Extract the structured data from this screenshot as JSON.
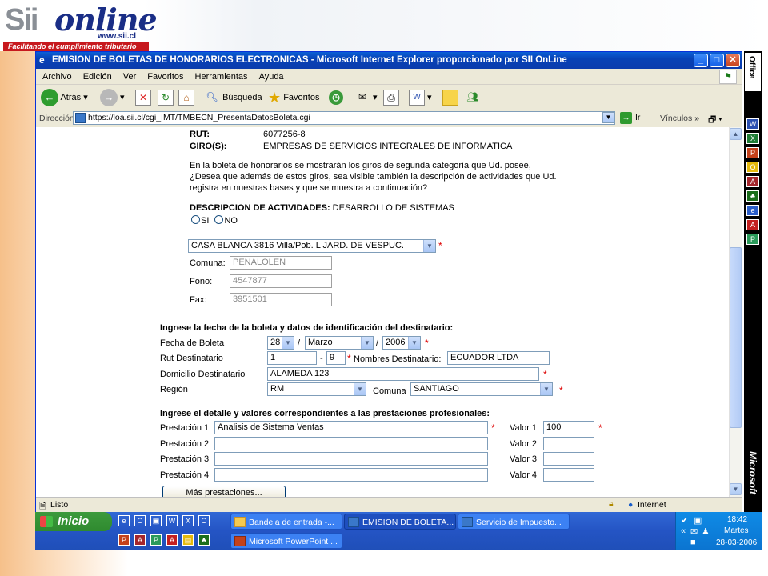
{
  "slide": {
    "logo_sii": "Sii",
    "logo_online": "online",
    "logo_url": "www.sii.cl",
    "logo_tagline": "Facilitando el cumplimiento tributario"
  },
  "window": {
    "title": "EMISION DE BOLETAS DE HONORARIOS ELECTRONICAS - Microsoft Internet Explorer proporcionado por SII OnLine",
    "menu": [
      "Archivo",
      "Edición",
      "Ver",
      "Favoritos",
      "Herramientas",
      "Ayuda"
    ],
    "toolbar": {
      "back": "Atrás",
      "search": "Búsqueda",
      "favorites": "Favoritos"
    },
    "address_label": "Dirección",
    "address_url": "https://loa.sii.cl/cgi_IMT/TMBECN_PresentaDatosBoleta.cgi",
    "go_label": "Ir",
    "links_label": "Vínculos",
    "status_left": "Listo",
    "status_zone": "Internet"
  },
  "page": {
    "rut_label": "RUT:",
    "rut_value": "6077256-8",
    "giros_label": "GIRO(S):",
    "giros_value": "EMPRESAS DE SERVICIOS INTEGRALES DE INFORMATICA",
    "info_line1": "En la boleta de honorarios se mostrarán los giros de segunda categoría que Ud. posee,",
    "info_line2": "¿Desea que además de estos giros, sea visible también la descripción de actividades que Ud.",
    "info_line3": "registra en nuestras bases y que se muestra a continuación?",
    "desc_label": "DESCRIPCION DE ACTIVIDADES:",
    "desc_value": "DESARROLLO DE SISTEMAS",
    "radio_si": "SI",
    "radio_no": "NO",
    "address_select": "CASA BLANCA 3816 Villa/Pob. L JARD. DE VESPUC.",
    "comuna_label": "Comuna:",
    "comuna_value": "PENALOLEN",
    "fono_label": "Fono:",
    "fono_value": "4547877",
    "fax_label": "Fax:",
    "fax_value": "3951501",
    "section1": "Ingrese la fecha de la boleta y datos de identificación del destinatario:",
    "fecha_label": "Fecha de Boleta",
    "fecha_day": "28",
    "fecha_month": "Marzo",
    "fecha_year": "2006",
    "rut_dest_label": "Rut Destinatario",
    "rut_dest_value": "1",
    "rut_dest_dv": "9",
    "nombres_label": "Nombres Destinatario:",
    "nombres_value": "ECUADOR LTDA",
    "domicilio_label": "Domicilio Destinatario",
    "domicilio_value": "ALAMEDA 123",
    "region_label": "Región",
    "region_value": "RM",
    "comuna2_label": "Comuna",
    "comuna2_value": "SANTIAGO",
    "section2": "Ingrese el detalle y valores correspondientes a las prestaciones profesionales:",
    "prestaciones": [
      {
        "label": "Prestación 1",
        "value": "Analisis de Sistema Ventas",
        "valor_label": "Valor 1",
        "valor": "100"
      },
      {
        "label": "Prestación 2",
        "value": "",
        "valor_label": "Valor 2",
        "valor": ""
      },
      {
        "label": "Prestación 3",
        "value": "",
        "valor_label": "Valor 3",
        "valor": ""
      },
      {
        "label": "Prestación 4",
        "value": "",
        "valor_label": "Valor 4",
        "valor": ""
      }
    ],
    "mas_button": "Más prestaciones..."
  },
  "office_bar": {
    "top_label": "Office",
    "bottom_label": "Microsoft"
  },
  "taskbar": {
    "start": "Inicio",
    "tasks_row1": [
      "Bandeja de entrada -...",
      "EMISION DE BOLETA...",
      "Servicio de Impuesto..."
    ],
    "tasks_row2": [
      "Microsoft PowerPoint ..."
    ],
    "clock_time": "18:42",
    "clock_day": "Martes",
    "clock_date": "28-03-2006"
  }
}
